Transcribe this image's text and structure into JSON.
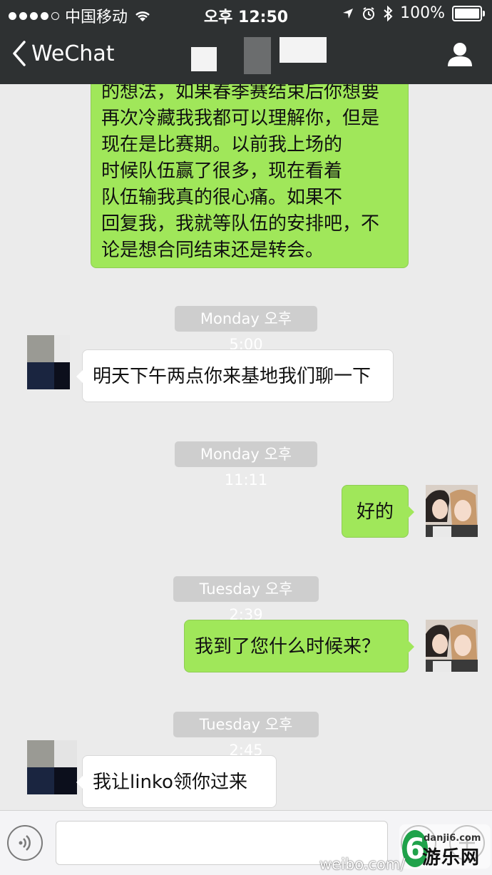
{
  "status_bar": {
    "carrier": "中国移动",
    "time": "오후 12:50",
    "battery": "100%"
  },
  "nav": {
    "back_label": "WeChat"
  },
  "messages": [
    {
      "type": "text",
      "side": "right",
      "text_lines": [
        "的想法，如果春季赛结束后你想要",
        "再次冷藏我我都可以理解你，但是",
        "现在是比赛期。以前我上场的",
        "时候队伍赢了很多，现在看着",
        "队伍输我真的很心痛。如果不",
        "回复我，我就等队伍的安排吧，不",
        "论是想合同结束还是转会。"
      ]
    },
    {
      "type": "time",
      "text": "Monday 오후 5:00"
    },
    {
      "type": "text",
      "side": "left",
      "text": "明天下午两点你来基地我们聊一下"
    },
    {
      "type": "time",
      "text": "Monday 오후 11:11"
    },
    {
      "type": "text",
      "side": "right",
      "text": "好的"
    },
    {
      "type": "time",
      "text": "Tuesday 오후 2:39"
    },
    {
      "type": "text",
      "side": "right",
      "text": "我到了您什么时候来？"
    },
    {
      "type": "time",
      "text": "Tuesday 오후 2:45"
    },
    {
      "type": "text",
      "side": "left",
      "text": "我让linko领你过来"
    }
  ],
  "watermarks": {
    "weibo": "weibo.com/",
    "site": "danji6.com",
    "site_name": "游乐网",
    "logo_digit": "6"
  },
  "colors": {
    "header_bg": "#2e3132",
    "chat_bg": "#ebebeb",
    "bubble_green": "#a0e75a",
    "bubble_white": "#ffffff",
    "timestamp_bg": "#cecece"
  },
  "icons": [
    "signal-dots-icon",
    "wifi-icon",
    "location-arrow-icon",
    "alarm-icon",
    "bluetooth-icon",
    "battery-icon",
    "back-chevron-icon",
    "person-icon",
    "voice-icon",
    "emoji-icon",
    "plus-icon"
  ]
}
